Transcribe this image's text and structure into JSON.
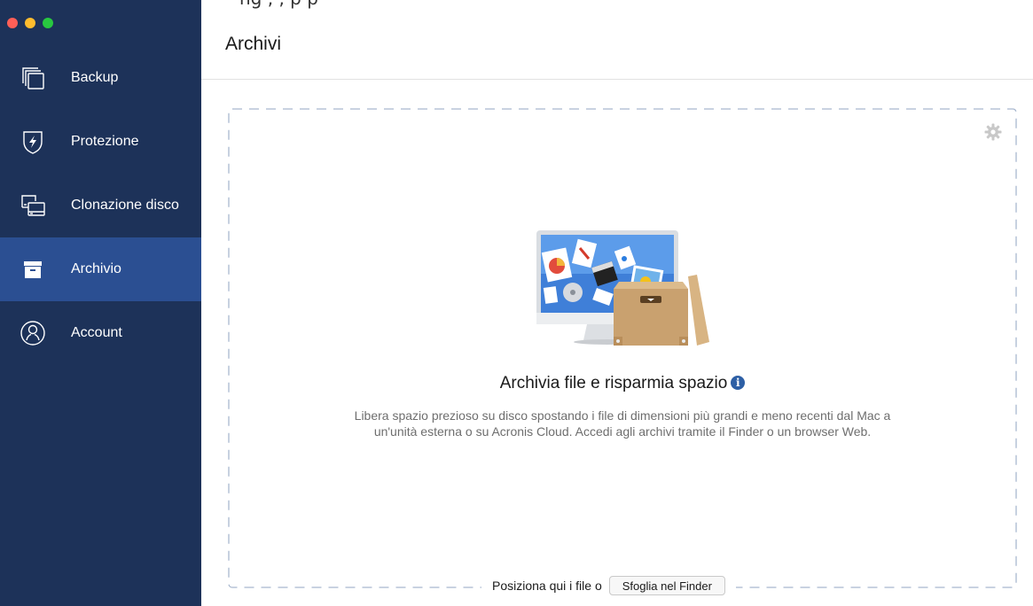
{
  "window": {
    "traffic_lights": [
      "close",
      "minimize",
      "zoom"
    ],
    "top_clipped_text": "ng  ,  ,  p    p"
  },
  "sidebar": {
    "background": "#1d3259",
    "active_background": "#2b4f92",
    "items": [
      {
        "label": "Backup",
        "icon": "backup-icon",
        "active": false
      },
      {
        "label": "Protezione",
        "icon": "shield-bolt-icon",
        "active": false
      },
      {
        "label": "Clonazione disco",
        "icon": "disk-clone-icon",
        "active": false
      },
      {
        "label": "Archivio",
        "icon": "archive-box-icon",
        "active": true
      },
      {
        "label": "Account",
        "icon": "account-icon",
        "active": false
      }
    ]
  },
  "header": {
    "title": "Archivi"
  },
  "dropzone": {
    "settings_icon": "gear-icon",
    "heading": "Archivia file e risparmia spazio",
    "info_icon": "info-icon",
    "description": "Libera spazio prezioso su disco spostando i file di dimensioni più grandi e meno recenti dal Mac a un'unità esterna o su Acronis Cloud. Accedi agli archivi tramite il Finder o un browser Web.",
    "drop_text": "Posiziona qui i file o",
    "browse_button": "Sfoglia nel Finder",
    "border_color": "#a9b8cf"
  }
}
